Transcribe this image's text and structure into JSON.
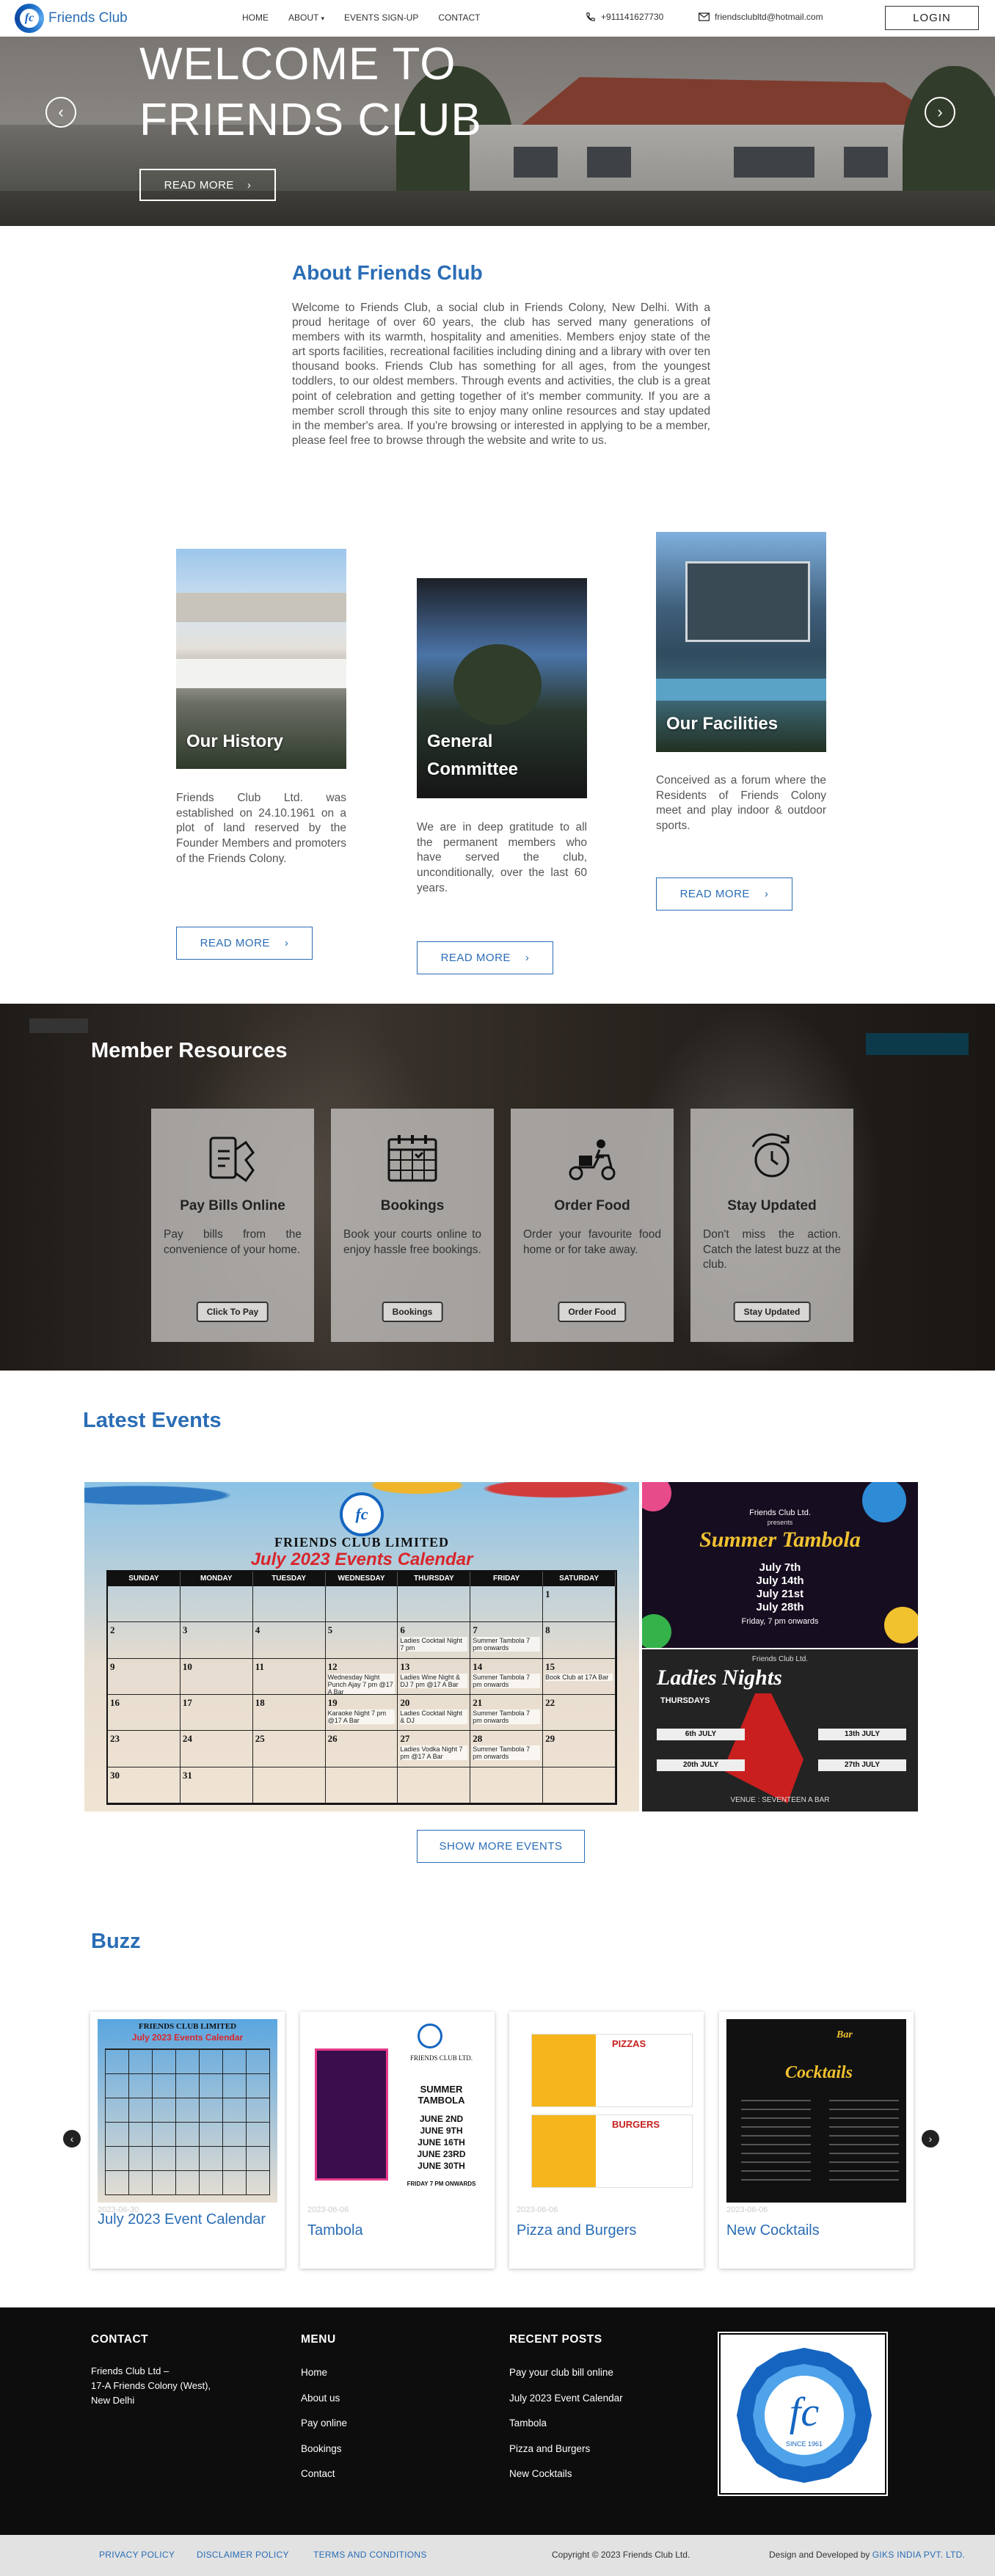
{
  "header": {
    "logo_mark": "fc",
    "logo_text": "Friends Club",
    "nav": [
      "HOME",
      "ABOUT",
      "EVENTS SIGN-UP",
      "CONTACT"
    ],
    "about_caret": "▾",
    "phone": "+911141627730",
    "email": "friendsclubltd@hotmail.com",
    "login": "LOGIN"
  },
  "hero": {
    "title_line1": "WELCOME TO",
    "title_line2": "FRIENDS CLUB",
    "button": "READ MORE"
  },
  "about": {
    "heading": "About Friends Club",
    "text": "Welcome to Friends Club, a social club in Friends Colony, New Delhi. With a proud heritage of over 60 years, the club has served many generations of members with its warmth, hospitality and amenities. Members enjoy state of the art sports facilities, recreational facilities including dining and a library with over ten thousand books. Friends Club has something for all ages, from the youngest toddlers, to our oldest members. Through events and activities, the club is a great point of celebration and getting together of it's member community. If you are a member scroll through this site to enjoy many online resources and stay updated in the member's area. If you're browsing or interested in applying to be a member, please feel free to browse through the website and write to us."
  },
  "cards": [
    {
      "title": "Our History",
      "text": "Friends Club Ltd. was established on 24.10.1961 on a plot of land reserved by the Founder Members and promoters of the Friends Colony.",
      "button": "READ MORE"
    },
    {
      "title": "General Committee",
      "text": "We are in deep gratitude to all the permanent members who have served the club, unconditionally, over the last 60 years.",
      "button": "READ MORE"
    },
    {
      "title": "Our Facilities",
      "text": "Conceived as a forum where the Residents of Friends Colony meet and play indoor & outdoor sports.",
      "button": "READ MORE"
    }
  ],
  "resources": {
    "heading": "Member Resources",
    "items": [
      {
        "title": "Pay Bills Online",
        "text": "Pay bills from the convenience of your home.",
        "button": "Click To Pay",
        "icon": "bill-hand-icon"
      },
      {
        "title": "Bookings",
        "text": "Book your courts online to enjoy hassle free bookings.",
        "button": "Bookings",
        "icon": "calendar-icon"
      },
      {
        "title": "Order Food",
        "text": "Order your favourite food home or for take away.",
        "button": "Order Food",
        "icon": "scooter-delivery-icon"
      },
      {
        "title": "Stay Updated",
        "text": "Don't miss the action. Catch the latest buzz at the club.",
        "button": "Stay Updated",
        "icon": "clock-icon"
      }
    ]
  },
  "events": {
    "heading": "Latest Events",
    "calendar": {
      "club": "FRIENDS CLUB LIMITED",
      "title": "July 2023 Events Calendar",
      "days": [
        "SUNDAY",
        "MONDAY",
        "TUESDAY",
        "WEDNESDAY",
        "THURSDAY",
        "FRIDAY",
        "SATURDAY"
      ],
      "rows": [
        [
          "",
          "",
          "",
          "",
          "",
          "",
          "1"
        ],
        [
          "2",
          "3",
          "4",
          "5",
          "6",
          "7",
          "8"
        ],
        [
          "9",
          "10",
          "11",
          "12",
          "13",
          "14",
          "15"
        ],
        [
          "16",
          "17",
          "18",
          "19",
          "20",
          "21",
          "22"
        ],
        [
          "23",
          "24",
          "25",
          "26",
          "27",
          "28",
          "29"
        ],
        [
          "30",
          "31",
          "",
          "",
          "",
          "",
          ""
        ]
      ],
      "notes": [
        {
          "day": "6",
          "text": "Ladies Cocktail Night 7 pm"
        },
        {
          "day": "7",
          "text": "Summer Tambola 7 pm onwards"
        },
        {
          "day": "12",
          "text": "Wednesday Night Punch Ajay 7 pm @17 A Bar"
        },
        {
          "day": "13",
          "text": "Ladies Wine Night & DJ 7 pm @17 A Bar"
        },
        {
          "day": "14",
          "text": "Summer Tambola 7 pm onwards"
        },
        {
          "day": "15",
          "text": "Book Club at 17A Bar"
        },
        {
          "day": "19",
          "text": "Karaoke Night 7 pm @17 A Bar"
        },
        {
          "day": "20",
          "text": "Ladies Cocktail Night & DJ"
        },
        {
          "day": "21",
          "text": "Summer Tambola 7 pm onwards"
        },
        {
          "day": "27",
          "text": "Ladies Vodka Night 7 pm @17 A Bar"
        },
        {
          "day": "28",
          "text": "Summer Tambola 7 pm onwards"
        }
      ]
    },
    "tambola": {
      "club": "Friends Club Ltd.",
      "presents": "presents",
      "title": "Summer Tambola",
      "dates": [
        "July 7th",
        "July 14th",
        "July 21st",
        "July 28th"
      ],
      "time": "Friday, 7 pm onwards"
    },
    "ladies": {
      "club": "Friends Club Ltd.",
      "title": "Ladies Nights",
      "subtitle": "THURSDAYS",
      "dates": [
        "6th JULY",
        "13th JULY",
        "20th JULY",
        "27th JULY"
      ],
      "venue": "VENUE : SEVENTEEN A BAR"
    },
    "show_more": "SHOW MORE EVENTS"
  },
  "buzz": {
    "heading": "Buzz",
    "items": [
      {
        "date": "2023-06-30",
        "title": "July 2023 Event Calendar"
      },
      {
        "date": "2023-06-06",
        "title": "Tambola",
        "poster_club": "FRIENDS CLUB LTD.",
        "poster_title": "SUMMER TAMBOLA",
        "poster_dates": [
          "JUNE 2ND",
          "JUNE 9TH",
          "JUNE 16TH",
          "JUNE 23RD",
          "JUNE 30TH"
        ],
        "poster_footer": "FRIDAY 7 PM ONWARDS"
      },
      {
        "date": "2023-06-06",
        "title": "Pizza and Burgers",
        "poster_a": "PIZZAS",
        "poster_b": "BURGERS"
      },
      {
        "date": "2023-06-06",
        "title": "New Cocktails",
        "poster_a": "Bar",
        "poster_b": "Cocktails"
      }
    ]
  },
  "footer": {
    "contact_h": "CONTACT",
    "contact_lines": [
      "Friends Club Ltd –",
      "17-A Friends Colony (West),",
      "New Delhi"
    ],
    "menu_h": "MENU",
    "menu": [
      "Home",
      "About us",
      "Pay online",
      "Bookings",
      "Contact"
    ],
    "posts_h": "RECENT POSTS",
    "posts": [
      "Pay your club bill online",
      "July 2023 Event Calendar",
      "Tambola",
      "Pizza and Burgers",
      "New Cocktails"
    ],
    "since": "SINCE 1961",
    "links": [
      "PRIVACY POLICY",
      "DISCLAIMER POLICY",
      "TERMS AND CONDITIONS"
    ],
    "copyright": "Copyright © 2023 Friends Club Ltd.",
    "dev_prefix": "Design and Developed by",
    "dev_name": "GIKS INDIA PVT. LTD."
  },
  "colors": {
    "primary": "#2a6db5",
    "footer_bg": "#0d0d0d",
    "footer_bar": "#e2e2e2"
  }
}
